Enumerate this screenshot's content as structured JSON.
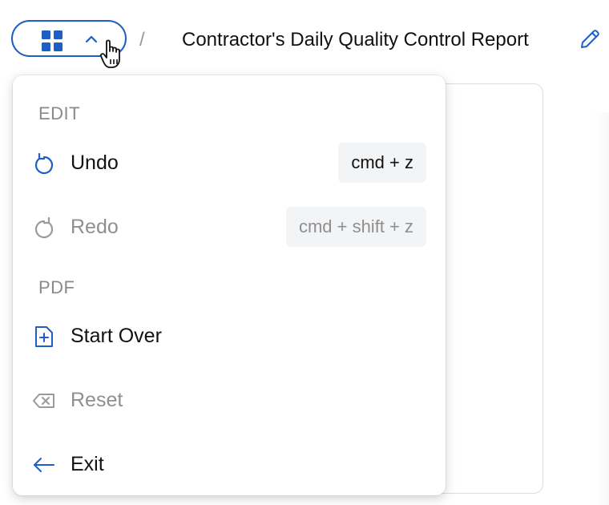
{
  "header": {
    "breadcrumb_separator": "/",
    "document_title": "Contractor's Daily Quality Control Report",
    "menu_toggle_icons": [
      "grid-icon",
      "chevron-up-icon"
    ],
    "edit_icon": "pencil-icon"
  },
  "menu": {
    "sections": [
      {
        "label": "EDIT",
        "items": [
          {
            "label": "Undo",
            "shortcut": "cmd + z",
            "icon": "undo-icon",
            "enabled": true
          },
          {
            "label": "Redo",
            "shortcut": "cmd + shift + z",
            "icon": "redo-icon",
            "enabled": false
          }
        ]
      },
      {
        "label": "PDF",
        "items": [
          {
            "label": "Start Over",
            "icon": "new-document-icon",
            "enabled": true
          },
          {
            "label": "Reset",
            "icon": "backspace-icon",
            "enabled": false
          },
          {
            "label": "Exit",
            "icon": "arrow-left-icon",
            "enabled": true
          }
        ]
      }
    ]
  },
  "colors": {
    "accent": "#1f5fc5",
    "disabled_text": "#8f8f8f",
    "shortcut_bg": "#f3f4f6"
  }
}
